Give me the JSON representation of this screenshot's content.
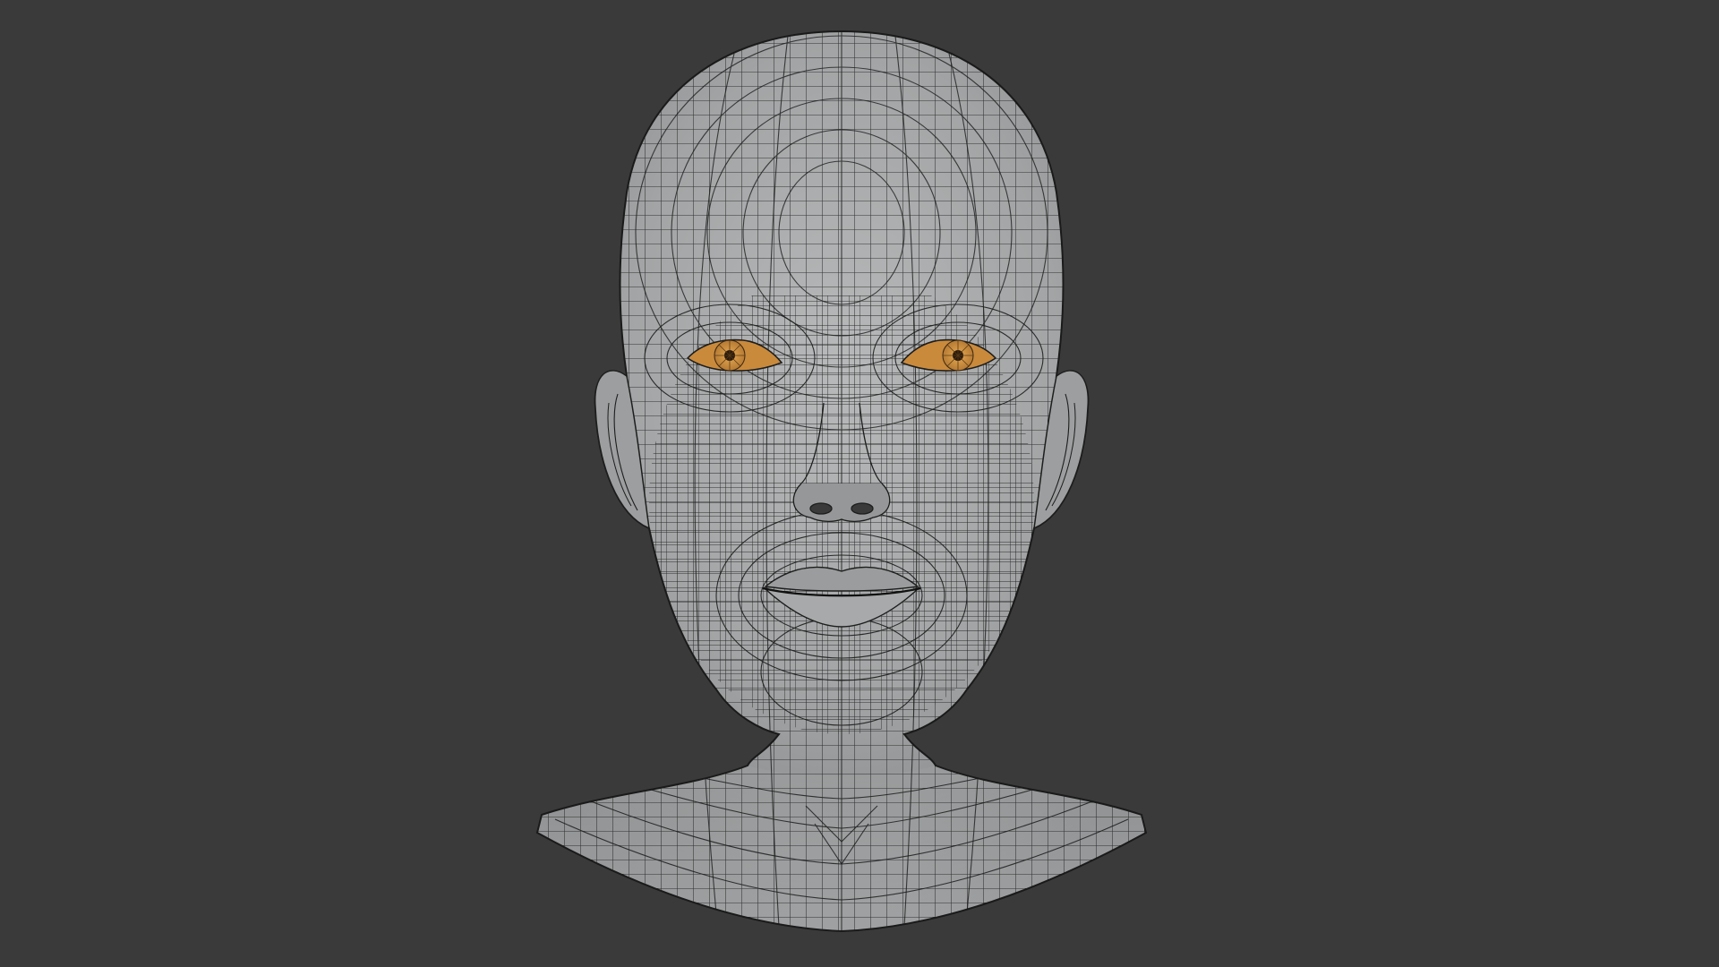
{
  "viewport": {
    "background_color": "#3a3a3a",
    "mesh_surface_color": "#a4a6a7",
    "wireframe_color": "#1d1d1d",
    "eye_iris_color": "#c98a3c",
    "eye_pupil_color": "#2a1a0c"
  },
  "model": {
    "object": "head-bust",
    "display_mode": "wireframe-overlay"
  }
}
